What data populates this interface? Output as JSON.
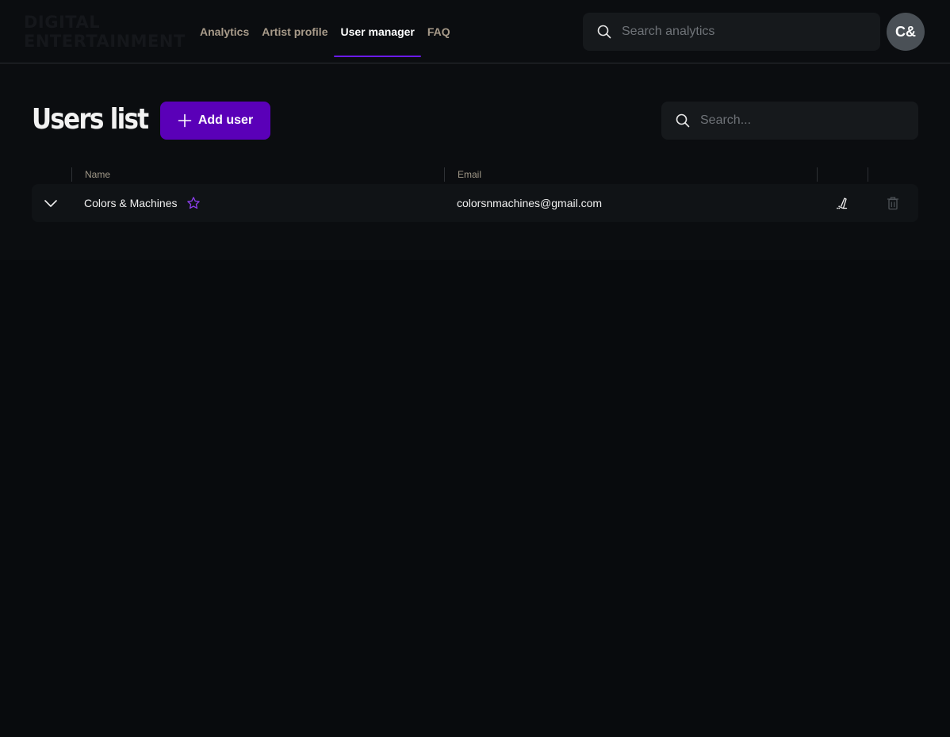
{
  "logo": {
    "line1": "DIGITAL",
    "line2": "ENTERTAINMENT"
  },
  "nav": {
    "items": [
      {
        "label": "Analytics",
        "active": false
      },
      {
        "label": "Artist profile",
        "active": false
      },
      {
        "label": "User manager",
        "active": true
      },
      {
        "label": "FAQ",
        "active": false
      }
    ]
  },
  "top_search": {
    "placeholder": "Search analytics"
  },
  "avatar": {
    "initials": "C&"
  },
  "page": {
    "title": "Users list",
    "add_button_label": "Add user",
    "search_placeholder": "Search..."
  },
  "table": {
    "columns": [
      "Name",
      "Email"
    ],
    "rows": [
      {
        "name": "Colors & Machines",
        "email": "colorsnmachines@gmail.com",
        "favorite": false
      }
    ]
  },
  "colors": {
    "accent": "#5a00b8",
    "nav_underline": "#6a1be8",
    "star": "#8a3ee8"
  }
}
